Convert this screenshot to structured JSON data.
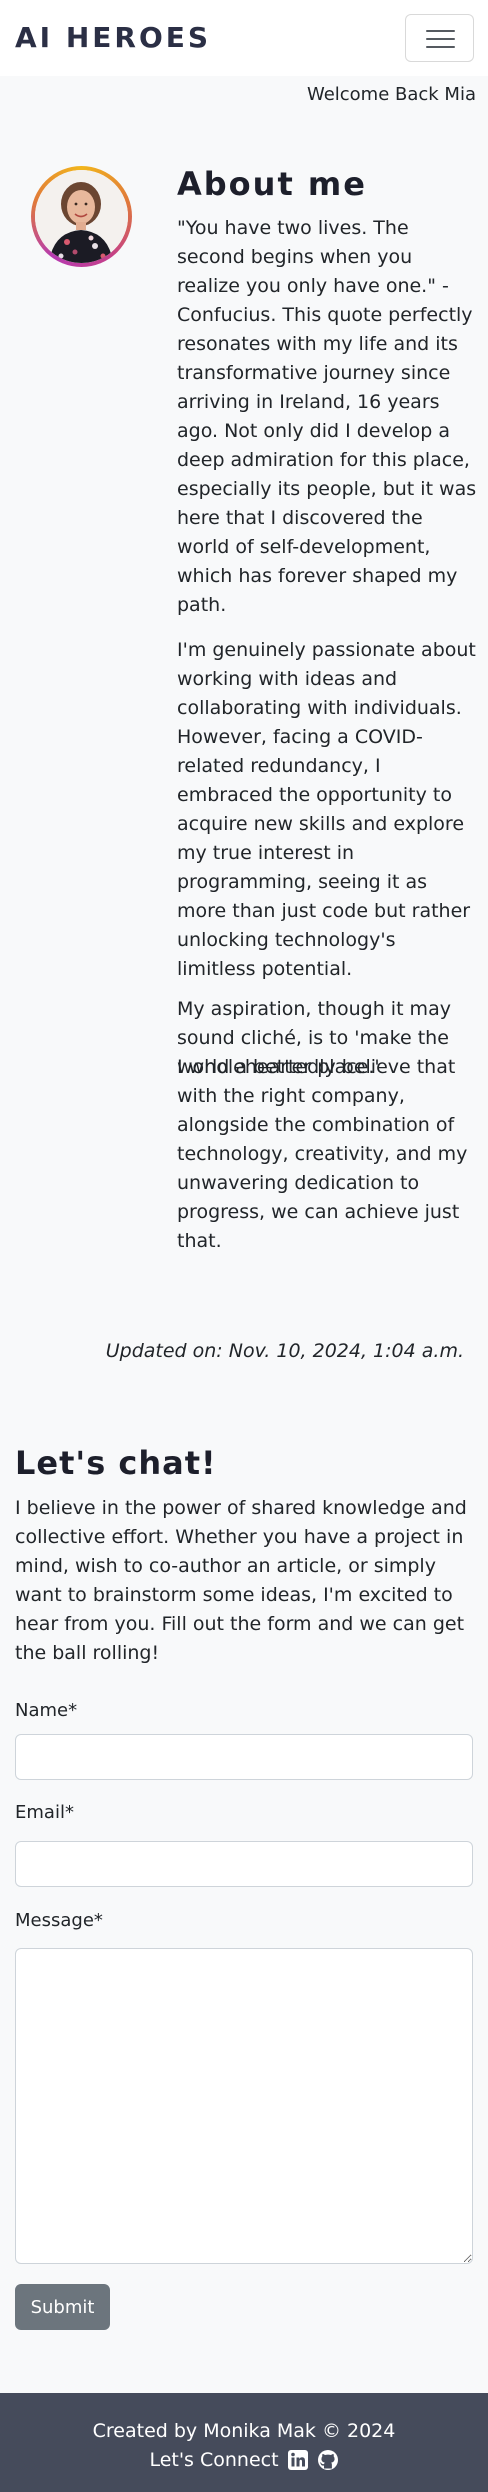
{
  "navbar": {
    "brand": "AI HEROES",
    "menu_icon": "hamburger-menu-icon"
  },
  "welcome": "Welcome Back Mia",
  "about": {
    "title": "About me",
    "paragraph1": "\"You have two lives. The second begins when you realize you only have one.\" - Confucius. This quote perfectly resonates with my life and its transformative journey since arriving in Ireland, 16 years ago. Not only did I develop a deep admiration for this place, especially its people, but it was here that I discovered the world of self-development, which has forever shaped my path.",
    "paragraph2": " I'm genuinely passionate about working with ideas and collaborating with individuals. However, facing a COVID-related redundancy, I embraced the opportunity to acquire new skills and explore my true interest in programming, seeing it as more than just code but rather unlocking technology's limitless potential.",
    "paragraph3": "My aspiration, though it may sound cliché, is to 'make the world a better place.'",
    "paragraph4": "I wholeheartedly believe that with the right company, alongside the combination of technology, creativity, and my unwavering dedication to progress, we can achieve just that.",
    "updated": "Updated on: Nov. 10, 2024, 1:04 a.m."
  },
  "chat": {
    "title": "Let's chat!",
    "intro": "I believe in the power of shared knowledge and collective effort. Whether you have a project in mind, wish to co-author an article, or simply want to brainstorm some ideas, I'm excited to hear from you. Fill out the form and we can get the ball rolling!",
    "name_label": "Name*",
    "name_value": "",
    "email_label": "Email*",
    "email_value": "",
    "message_label": "Message*",
    "message_value": "",
    "submit_label": "Submit"
  },
  "footer": {
    "credit": "Created by Monika Mak © 2024",
    "connect": "Let's Connect",
    "icons": [
      "linkedin-icon",
      "github-icon"
    ]
  },
  "colors": {
    "navbar_bg": "#ffffff",
    "page_bg": "#f8f9fa",
    "footer_bg": "#454b5b",
    "button_bg": "#6c757d",
    "avatar_ring": [
      "#f2b61c",
      "#c43f89"
    ]
  }
}
